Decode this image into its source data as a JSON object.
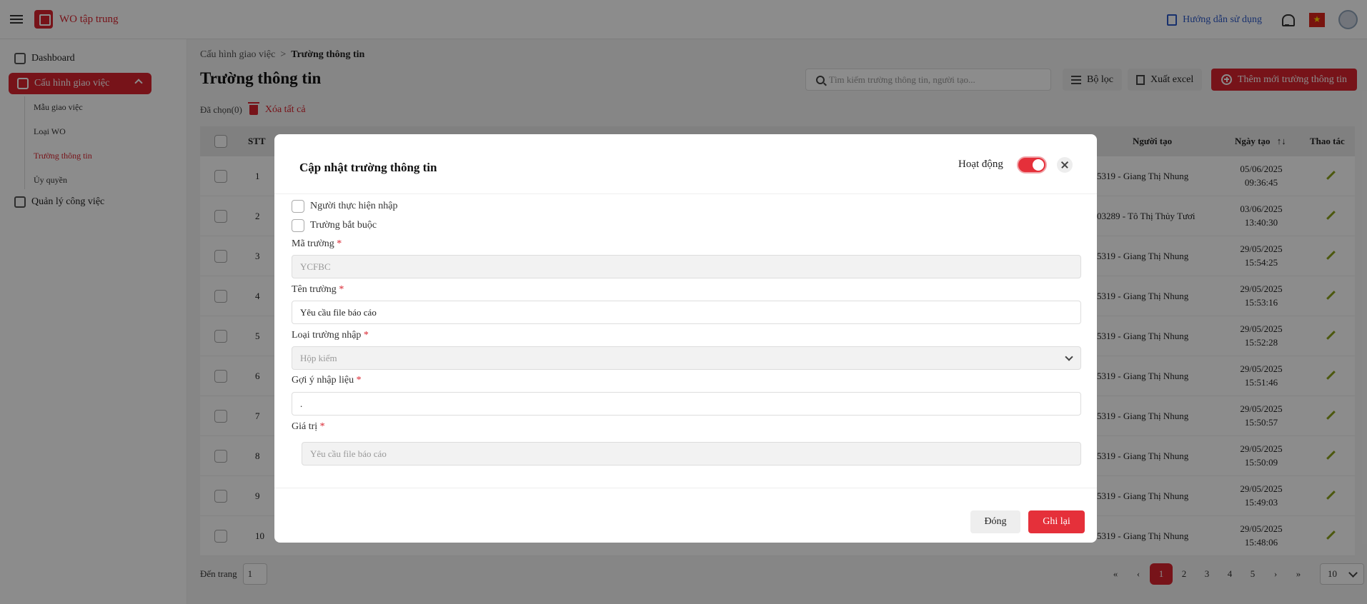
{
  "app": {
    "title": "WO tập trung"
  },
  "topbar": {
    "guide_label": "Hướng dẫn sử dụng",
    "flag_symbol": "★"
  },
  "sidebar": {
    "dashboard": "Dashboard",
    "task_config": "Cấu hình giao việc",
    "sub_items": [
      "Mẫu giao việc",
      "Loại WO",
      "Trường thông tin",
      "Ủy quyền"
    ],
    "work_mgmt": "Quản lý công việc"
  },
  "breadcrumb": {
    "parent": "Cấu hình giao việc",
    "separator": ">",
    "current": "Trường thông tin"
  },
  "page": {
    "title": "Trường thông tin",
    "search_placeholder": "Tìm kiếm trường thông tin, người tạo...",
    "filter_label": "Bộ lọc",
    "export_label": "Xuất excel",
    "add_label": "Thêm mới trường thông tin",
    "selected_label": "Đã chọn(0)",
    "clear_all_label": "Xóa tất cả"
  },
  "table": {
    "headers": {
      "stt": "STT",
      "creator": "Người tạo",
      "created_date": "Ngày tạo",
      "actions": "Thao tác"
    },
    "rows": [
      {
        "stt": "1",
        "creator": "5319 - Giang Thị Nhung",
        "date": "05/06/2025",
        "time": "09:36:45"
      },
      {
        "stt": "2",
        "creator": "03289 - Tô Thị Thủy Tươi",
        "date": "03/06/2025",
        "time": "13:40:30"
      },
      {
        "stt": "3",
        "creator": "5319 - Giang Thị Nhung",
        "date": "29/05/2025",
        "time": "15:54:25"
      },
      {
        "stt": "4",
        "creator": "5319 - Giang Thị Nhung",
        "date": "29/05/2025",
        "time": "15:53:16"
      },
      {
        "stt": "5",
        "creator": "5319 - Giang Thị Nhung",
        "date": "29/05/2025",
        "time": "15:52:28"
      },
      {
        "stt": "6",
        "creator": "5319 - Giang Thị Nhung",
        "date": "29/05/2025",
        "time": "15:51:46"
      },
      {
        "stt": "7",
        "creator": "5319 - Giang Thị Nhung",
        "date": "29/05/2025",
        "time": "15:50:57"
      },
      {
        "stt": "8",
        "creator": "5319 - Giang Thị Nhung",
        "date": "29/05/2025",
        "time": "15:50:09"
      },
      {
        "stt": "9",
        "creator": "5319 - Giang Thị Nhung",
        "date": "29/05/2025",
        "time": "15:49:03"
      },
      {
        "stt": "10",
        "creator": "5319 - Giang Thị Nhung",
        "date": "29/05/2025",
        "time": "15:48:06"
      }
    ]
  },
  "pagination": {
    "goto_label": "Đến trang",
    "goto_value": "1",
    "first": "«",
    "prev": "‹",
    "pages": [
      "1",
      "2",
      "3",
      "4",
      "5"
    ],
    "current_page": "1",
    "next": "›",
    "last": "»",
    "page_size": "10"
  },
  "modal": {
    "title": "Cập nhật trường thông tin",
    "active_label": "Hoạt động",
    "active": true,
    "checkbox_executor": "Người thực hiện nhập",
    "checkbox_required": "Trường bắt buộc",
    "field_code_label": "Mã trường",
    "field_code_value": "YCFBC",
    "field_name_label": "Tên trường",
    "field_name_value": "Yêu cầu file báo cáo",
    "input_type_label": "Loại trường nhập",
    "input_type_value": "Hộp kiểm",
    "hint_label": "Gợi ý nhập liệu",
    "hint_value": ".",
    "value_label": "Giá trị",
    "value_value": "Yêu cầu file báo cáo",
    "required_mark": "*",
    "close_button": "Đóng",
    "save_button": "Ghi lại"
  },
  "colors": {
    "brand": "#d9232e",
    "accent_blue": "#2d59c9"
  }
}
